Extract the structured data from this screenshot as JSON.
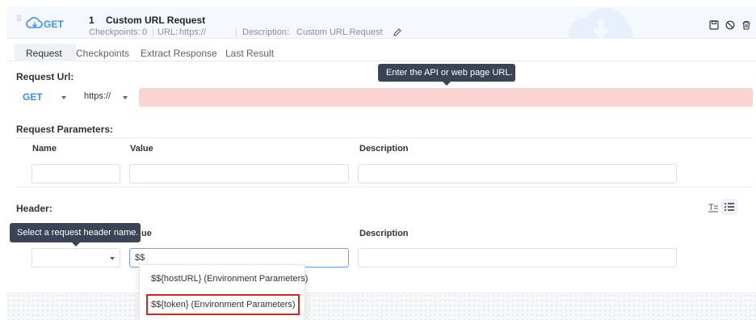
{
  "step": {
    "method": "GET",
    "number": "1",
    "name": "Custom URL Request",
    "checkpoints_label": "Checkpoints:",
    "checkpoints_value": "0",
    "url_label": "URL:",
    "url_value": "https://",
    "description_label": "Description:",
    "description_value": "Custom URL Request"
  },
  "tabs": [
    {
      "label": "Request",
      "active": true
    },
    {
      "label": "Checkpoints",
      "active": false
    },
    {
      "label": "Extract Response",
      "active": false
    },
    {
      "label": "Last Result",
      "active": false
    }
  ],
  "request_url": {
    "title": "Request Url:",
    "method": "GET",
    "protocol": "https://",
    "value": "",
    "tooltip": "Enter the API or web page URL."
  },
  "params": {
    "title": "Request Parameters:",
    "columns": [
      "Name",
      "Value",
      "Description"
    ]
  },
  "header": {
    "title": "Header:",
    "col_value_partial": "ue",
    "col_description": "Description",
    "tooltip": "Select a request header name.",
    "value_input": "$$",
    "suggestions": [
      "$${hostURL} (Environment Parameters)",
      "$${token} (Environment Parameters)"
    ]
  },
  "colors": {
    "accent": "#3d8ef8",
    "error_input": "#fbd4d1",
    "tooltip_bg": "#3a4456",
    "highlight_border": "#d9251d"
  },
  "icons": [
    "drag-handle-icon",
    "cloud-icon",
    "edit-icon",
    "save-icon",
    "disable-icon",
    "delete-icon",
    "text-mode-icon",
    "list-mode-icon"
  ]
}
